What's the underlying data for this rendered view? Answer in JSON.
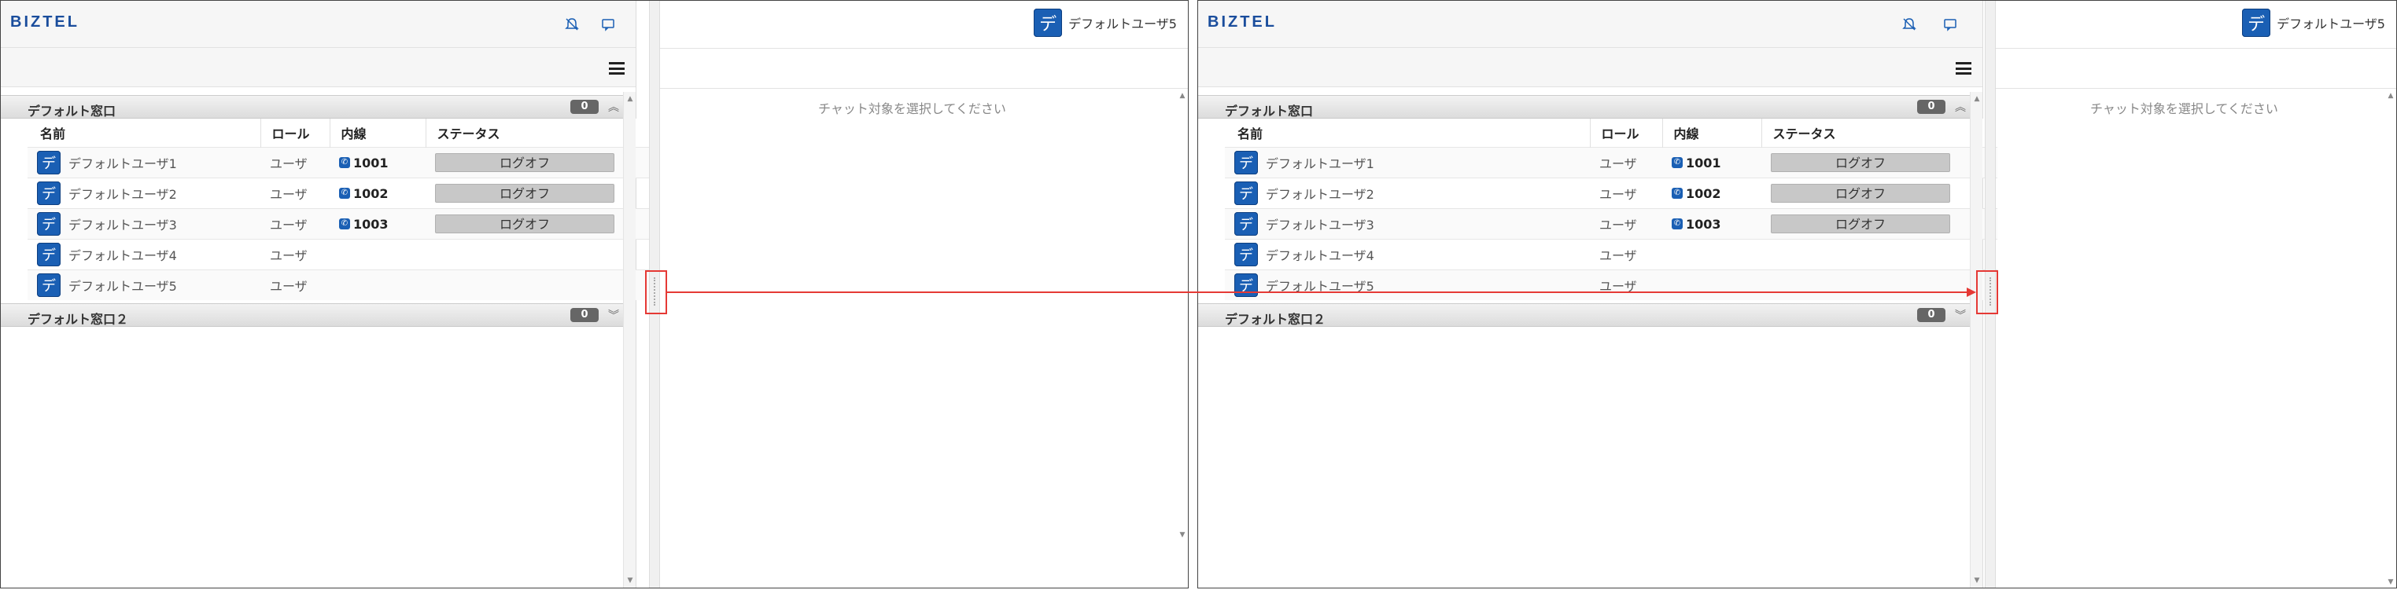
{
  "app": {
    "logo": "BIZTEL",
    "current_user": "デフォルトユーザ5",
    "current_user_avatar": "デ",
    "chat_placeholder": "チャット対象を選択してください"
  },
  "colors": {
    "brand": "#1a5fb4",
    "badge": "#666666",
    "status_offline": "#c8c8c8",
    "annotation": "#e53935"
  },
  "icons": {
    "notification": "bell-slash-icon",
    "chat": "chat-bubble-icon",
    "menu": "hamburger-menu-icon",
    "phone": "phone-icon"
  },
  "columns": {
    "name": "名前",
    "role": "ロール",
    "extension": "内線",
    "status": "ステータス"
  },
  "groups": [
    {
      "title": "デフォルト窓口",
      "count": "0",
      "chevron": "︽",
      "users": [
        {
          "avatar": "デ",
          "name": "デフォルトユーザ1",
          "role": "ユーザ",
          "extension": "1001",
          "status": "ログオフ"
        },
        {
          "avatar": "デ",
          "name": "デフォルトユーザ2",
          "role": "ユーザ",
          "extension": "1002",
          "status": "ログオフ"
        },
        {
          "avatar": "デ",
          "name": "デフォルトユーザ3",
          "role": "ユーザ",
          "extension": "1003",
          "status": "ログオフ"
        },
        {
          "avatar": "デ",
          "name": "デフォルトユーザ4",
          "role": "ユーザ",
          "extension": "",
          "status": ""
        },
        {
          "avatar": "デ",
          "name": "デフォルトユーザ5",
          "role": "ユーザ",
          "extension": "",
          "status": ""
        }
      ]
    },
    {
      "title": "デフォルト窓口２",
      "count": "0",
      "chevron": "︾"
    }
  ]
}
